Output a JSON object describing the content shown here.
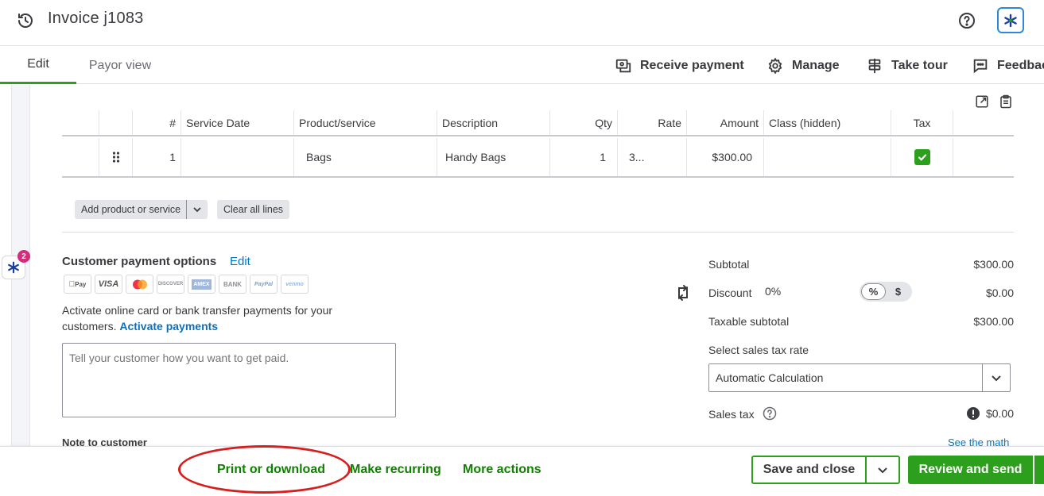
{
  "header": {
    "title": "Invoice j1083",
    "icons": [
      "history-icon",
      "help-icon",
      "ai-assistant-icon"
    ]
  },
  "tabs": [
    {
      "label": "Edit",
      "active": true
    },
    {
      "label": "Payor view",
      "active": false
    }
  ],
  "actions": [
    {
      "label": "Receive payment",
      "icon": "receipt-icon"
    },
    {
      "label": "Manage",
      "icon": "gear-icon"
    },
    {
      "label": "Take tour",
      "icon": "signpost-icon"
    },
    {
      "label": "Feedback",
      "icon": "chat-icon"
    }
  ],
  "sidebar": {
    "notification_count": "2"
  },
  "table": {
    "columns": [
      "#",
      "Service Date",
      "Product/service",
      "Description",
      "Qty",
      "Rate",
      "Amount",
      "Class (hidden)",
      "Tax"
    ],
    "rows": [
      {
        "num": "1",
        "service_date": "",
        "product": "Bags",
        "description": "Handy Bags",
        "qty": "1",
        "rate": "3...",
        "amount": "$300.00",
        "class": "",
        "tax_checked": true
      }
    ],
    "add_product_label": "Add product or service",
    "clear_lines_label": "Clear all lines"
  },
  "payment": {
    "title": "Customer payment options",
    "edit_label": "Edit",
    "logos": [
      "Pay",
      "VISA",
      "mastercard",
      "DISCOVER",
      "AMEX",
      "BANK",
      "PayPal",
      "venmo"
    ],
    "activate_text": "Activate online card or bank transfer payments for your customers.",
    "activate_link": "Activate payments",
    "textarea_placeholder": "Tell your customer how you want to get paid.",
    "note_label": "Note to customer"
  },
  "totals": {
    "subtotal_label": "Subtotal",
    "subtotal_value": "$300.00",
    "discount_label": "Discount",
    "discount_percent": "0%",
    "discount_toggle": [
      "%",
      "$"
    ],
    "discount_value": "$0.00",
    "taxable_label": "Taxable subtotal",
    "taxable_value": "$300.00",
    "tax_rate_label": "Select sales tax rate",
    "tax_rate_value": "Automatic Calculation",
    "sales_tax_label": "Sales tax",
    "sales_tax_value": "$0.00",
    "see_math": "See the math"
  },
  "footer": {
    "print_label": "Print or download",
    "recurring_label": "Make recurring",
    "more_label": "More actions",
    "save_close_label": "Save and close",
    "review_send_label": "Review and send"
  },
  "colors": {
    "accent": "#2ca01c",
    "link": "#0077c5",
    "annotation": "#d62020"
  }
}
